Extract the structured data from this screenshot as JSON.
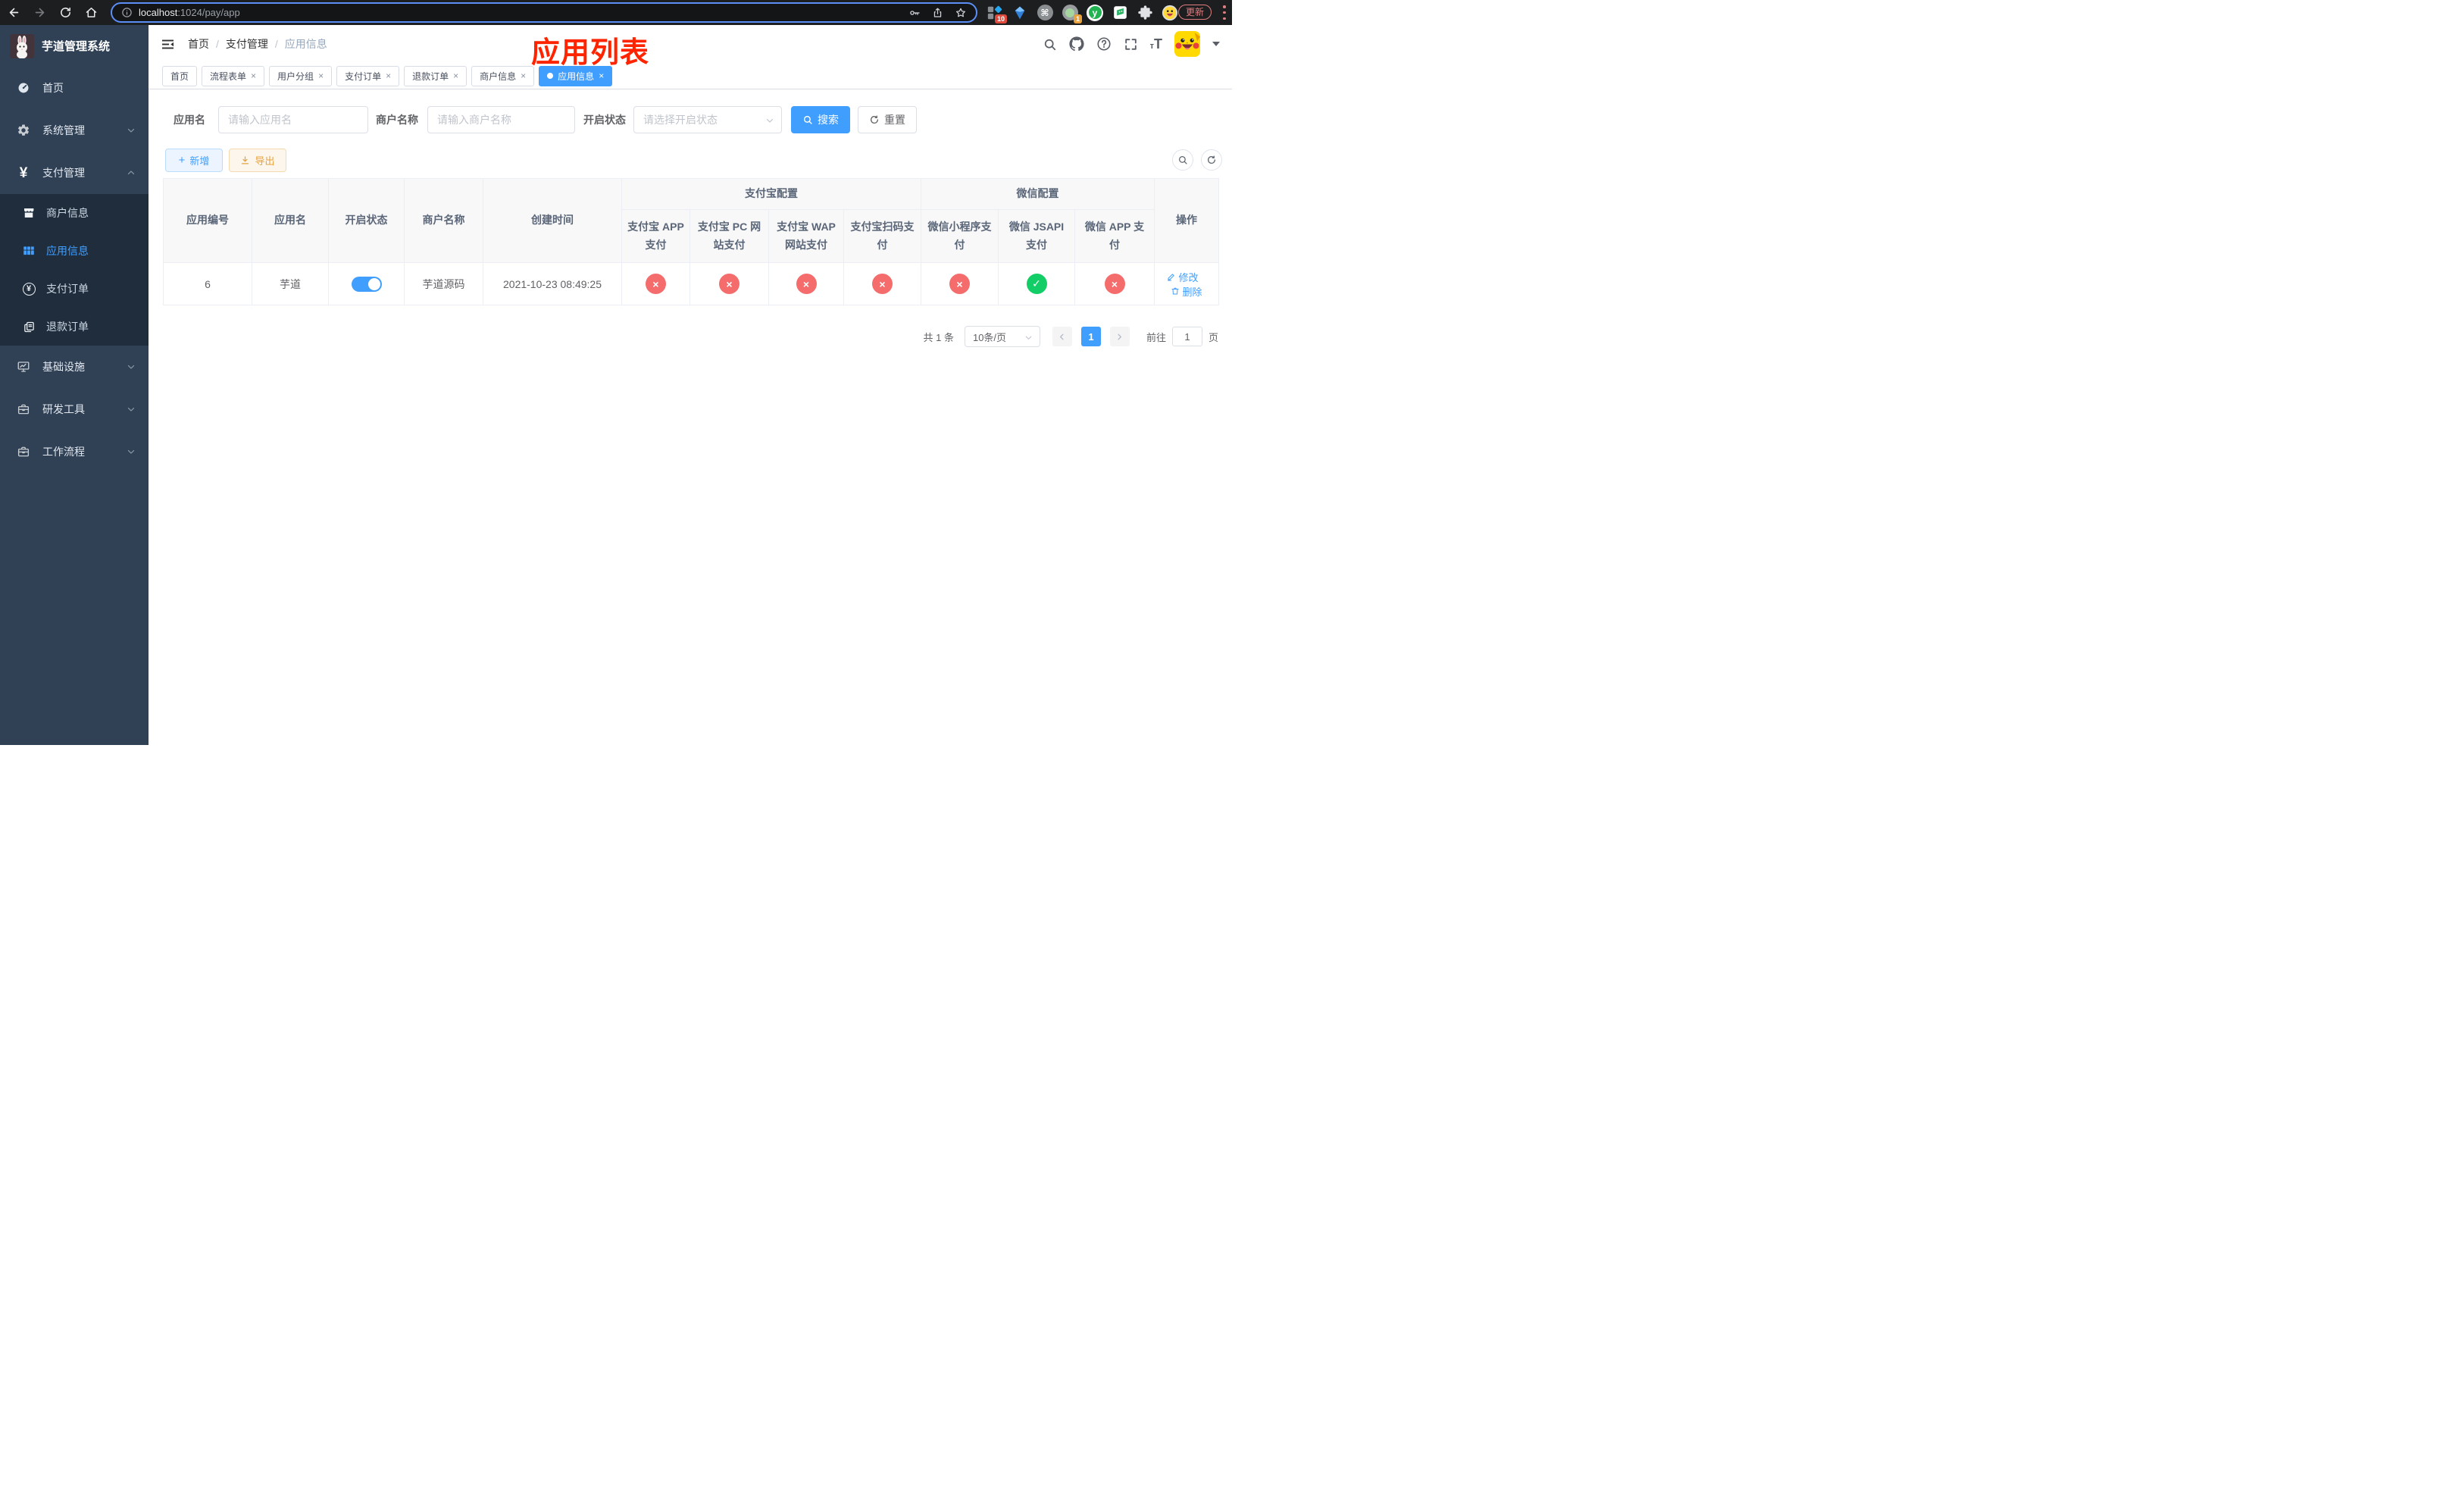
{
  "browser": {
    "url_host": "localhost",
    "url_path": ":1024/pay/app",
    "update_label": "更新",
    "extensions": {
      "badge_tampermonkey": "10",
      "badge_notifier": "1",
      "command_glyph": "⌘",
      "y_glyph": "y"
    }
  },
  "app": {
    "title": "芋道管理系统"
  },
  "sidebar": {
    "items": [
      {
        "label": "首页"
      },
      {
        "label": "系统管理"
      },
      {
        "label": "支付管理"
      },
      {
        "label": "基础设施"
      },
      {
        "label": "研发工具"
      },
      {
        "label": "工作流程"
      }
    ],
    "submenu": [
      {
        "label": "商户信息"
      },
      {
        "label": "应用信息"
      },
      {
        "label": "支付订单"
      },
      {
        "label": "退款订单"
      }
    ],
    "yen_glyph": "¥"
  },
  "header": {
    "breadcrumb": [
      "首页",
      "支付管理",
      "应用信息"
    ],
    "separator": "/",
    "annotation": "应用列表",
    "help_glyph": "?",
    "font_icon_small": "т",
    "font_icon_big": "T"
  },
  "tabs": {
    "close_glyph": "×",
    "items": [
      {
        "label": "首页"
      },
      {
        "label": "流程表单"
      },
      {
        "label": "用户分组"
      },
      {
        "label": "支付订单"
      },
      {
        "label": "退款订单"
      },
      {
        "label": "商户信息"
      },
      {
        "label": "应用信息"
      }
    ]
  },
  "filters": {
    "app_name_label": "应用名",
    "app_name_placeholder": "请输入应用名",
    "merchant_label": "商户名称",
    "merchant_placeholder": "请输入商户名称",
    "status_label": "开启状态",
    "status_placeholder": "请选择开启状态",
    "search_label": "搜索",
    "reset_label": "重置"
  },
  "toolbar": {
    "add_label": "新增",
    "export_label": "导出",
    "plus_glyph": "+"
  },
  "table": {
    "group_alipay": "支付宝配置",
    "group_wechat": "微信配置",
    "columns": [
      "应用编号",
      "应用名",
      "开启状态",
      "商户名称",
      "创建时间",
      "支付宝 APP 支付",
      "支付宝 PC 网站支付",
      "支付宝 WAP 网站支付",
      "支付宝扫码支付",
      "微信小程序支付",
      "微信 JSAPI 支付",
      "微信 APP 支付",
      "操作"
    ],
    "row": {
      "id": "6",
      "name": "芋道",
      "enabled": true,
      "merchant": "芋道源码",
      "created_at": "2021-10-23 08:49:25",
      "statuses": [
        "fail",
        "fail",
        "fail",
        "fail",
        "fail",
        "success",
        "fail"
      ],
      "edit_label": "修改",
      "delete_label": "删除"
    }
  },
  "pagination": {
    "total": "共 1 条",
    "page_size": "10条/页",
    "current_page": "1",
    "goto_label": "前往",
    "goto_value": "1",
    "page_unit": "页"
  },
  "colors": {
    "primary": "#409eff",
    "danger": "#f56c6c",
    "success": "#13ce66",
    "warning": "#e6a23c",
    "annotation": "#ff2400"
  }
}
